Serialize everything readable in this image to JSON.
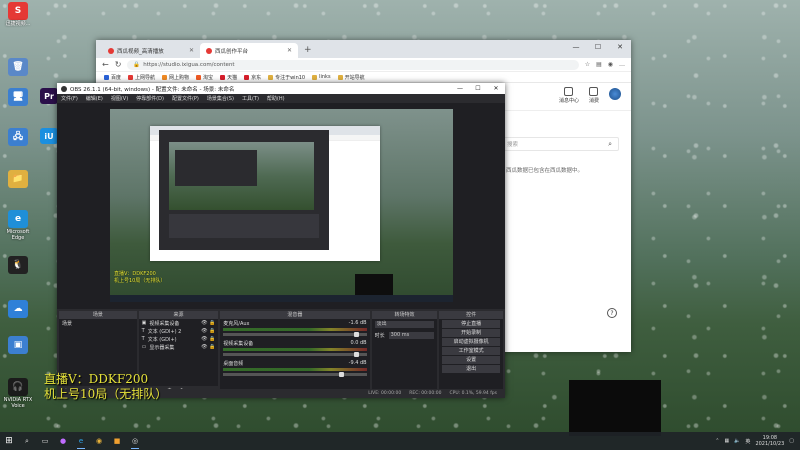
{
  "desktop": {
    "icons_col1": [
      {
        "name": "app-red-icon",
        "label": "迅捷视频...",
        "color": "#e53935",
        "glyph": "S"
      },
      {
        "name": "recycle-bin-icon",
        "label": "",
        "color": "#5a88c8",
        "glyph": "🗑"
      },
      {
        "name": "computer-icon",
        "label": "",
        "color": "#3c7fd0",
        "glyph": "🖥"
      },
      {
        "name": "network-icon",
        "label": "",
        "color": "#3c7fd0",
        "glyph": "🖧"
      },
      {
        "name": "folder-icon",
        "label": "",
        "color": "#e0b040",
        "glyph": "📁"
      },
      {
        "name": "edge-icon",
        "label": "Microsoft Edge",
        "color": "#1f8fd8",
        "glyph": "e"
      },
      {
        "name": "qq-icon",
        "label": "",
        "color": "#222",
        "glyph": "🐧"
      },
      {
        "name": "app-blue-icon",
        "label": "",
        "color": "#2f80d8",
        "glyph": "☁"
      },
      {
        "name": "app-screen-icon",
        "label": "",
        "color": "#3c7fd0",
        "glyph": "▣"
      },
      {
        "name": "headset-icon",
        "label": "NVIDIA RTX Voice",
        "color": "#1b1b1b",
        "glyph": "🎧"
      }
    ],
    "icons_col2": [
      {
        "name": "premiere-icon",
        "label": "",
        "color": "#2b0f4a",
        "glyph": "Pr"
      },
      {
        "name": "iu-app-icon",
        "label": "",
        "color": "#1b8fe0",
        "glyph": "iU"
      }
    ]
  },
  "browser": {
    "tabs": [
      {
        "label": "西瓜视频_高清播放",
        "favicon_color": "#e53935",
        "active": false
      },
      {
        "label": "西瓜创作平台",
        "favicon_color": "#e53935",
        "active": true
      }
    ],
    "new_tab": "+",
    "window_controls": {
      "minimize": "—",
      "maximize": "☐",
      "close": "✕"
    },
    "url": "https://studio.ixigua.com/content",
    "bookmarks": [
      {
        "label": "百度",
        "color": "#2a62d8"
      },
      {
        "label": "上网导航",
        "color": "#e53935"
      },
      {
        "label": "网上购物",
        "color": "#f08a24"
      },
      {
        "label": "淘宝",
        "color": "#f05a24"
      },
      {
        "label": "天猫",
        "color": "#d81e2b"
      },
      {
        "label": "京东",
        "color": "#d81e2b"
      },
      {
        "label": "专注于win10",
        "color": "#e0b040"
      },
      {
        "label": "links",
        "color": "#e0b040"
      },
      {
        "label": "开站导航",
        "color": "#e0b040"
      }
    ],
    "header_icons": [
      {
        "label": "消息中心"
      },
      {
        "label": "消费"
      }
    ],
    "search_placeholder": "搜索",
    "note": "西瓜数据已包含在西瓜数据中。",
    "help": "?"
  },
  "obs": {
    "title": "OBS 26.1.1 (64-bit, windows) - 配置文件: 未命名 - 场景: 未命名",
    "menu": [
      "文件(F)",
      "编辑(E)",
      "视图(V)",
      "停靠部件(D)",
      "配置文件(P)",
      "场景集合(S)",
      "工具(T)",
      "帮助(H)"
    ],
    "preview_overlay_lines": [
      "直播V：DDKF200",
      "机上号10局（无排队）"
    ],
    "docks": {
      "scenes": {
        "title": "场景",
        "items": [
          "场景"
        ]
      },
      "sources": {
        "title": "来源",
        "items": [
          "视频采集设备",
          "文本 (GDI+) 2",
          "文本 (GDI+)",
          "显示器采集"
        ]
      },
      "mixer": {
        "title": "混音器",
        "channels": [
          {
            "name": "麦克风/Aux",
            "db": "-1.6 dB"
          },
          {
            "name": "视频采集设备",
            "db": "0.0 dB"
          },
          {
            "name": "桌面音频",
            "db": "-9.4 dB"
          }
        ]
      },
      "transitions": {
        "title": "转场特效",
        "fade_label": "淡出",
        "duration_label": "时长",
        "duration_value": "300 ms"
      },
      "controls": {
        "title": "控件",
        "buttons": [
          "停止直播",
          "开始录制",
          "启动虚拟摄像机",
          "工作室模式",
          "设置",
          "退出"
        ]
      }
    },
    "status": [
      "LIVE: 00:00:00",
      "REC: 00:00:00",
      "CPU: 0.1%, 59.94 fps"
    ]
  },
  "overlay_text": [
    "直播V：DDKF200",
    "机上号10局（无排队）"
  ],
  "taskbar": {
    "clock_time": "19:08",
    "clock_date": "2021/10/23",
    "tray_lang": "英"
  }
}
